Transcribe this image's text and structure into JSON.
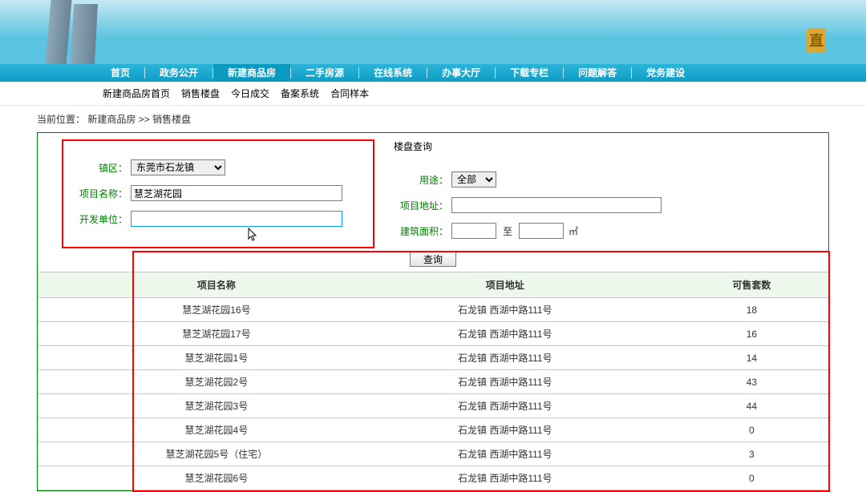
{
  "banner": {
    "right_glyph": "直"
  },
  "main_nav": [
    {
      "label": "首页",
      "active": false
    },
    {
      "label": "政务公开",
      "active": false
    },
    {
      "label": "新建商品房",
      "active": true
    },
    {
      "label": "二手房源",
      "active": false
    },
    {
      "label": "在线系统",
      "active": false
    },
    {
      "label": "办事大厅",
      "active": false
    },
    {
      "label": "下载专栏",
      "active": false
    },
    {
      "label": "问题解答",
      "active": false
    },
    {
      "label": "党务建设",
      "active": false
    }
  ],
  "sub_nav": [
    "新建商品房首页",
    "销售楼盘",
    "今日成交",
    "备案系统",
    "合同样本"
  ],
  "breadcrumb": {
    "label": "当前位置：",
    "items": [
      "新建商品房",
      "销售楼盘"
    ],
    "sep": " >> "
  },
  "search": {
    "section_title": "楼盘查询",
    "district_label": "镇区：",
    "district_value": "东莞市石龙镇",
    "project_name_label": "项目名称：",
    "project_name_value": "慧芝湖花园",
    "developer_label": "开发单位：",
    "developer_value": "",
    "usage_label": "用途：",
    "usage_value": "全部",
    "address_label": "项目地址：",
    "address_value": "",
    "area_label": "建筑面积：",
    "area_from": "",
    "area_to_label": "至",
    "area_to": "",
    "area_unit": "㎡",
    "query_btn": "查询"
  },
  "table": {
    "headers": [
      "项目名称",
      "项目地址",
      "可售套数"
    ],
    "rows": [
      {
        "name": "慧芝湖花园16号",
        "addr": "石龙镇  西湖中路111号",
        "count": "18"
      },
      {
        "name": "慧芝湖花园17号",
        "addr": "石龙镇  西湖中路111号",
        "count": "16"
      },
      {
        "name": "慧芝湖花园1号",
        "addr": "石龙镇  西湖中路111号",
        "count": "14"
      },
      {
        "name": "慧芝湖花园2号",
        "addr": "石龙镇  西湖中路111号",
        "count": "43"
      },
      {
        "name": "慧芝湖花园3号",
        "addr": "石龙镇  西湖中路111号",
        "count": "44"
      },
      {
        "name": "慧芝湖花园4号",
        "addr": "石龙镇  西湖中路111号",
        "count": "0"
      },
      {
        "name": "慧芝湖花园5号（住宅）",
        "addr": "石龙镇  西湖中路111号",
        "count": "3"
      },
      {
        "name": "慧芝湖花园6号",
        "addr": "石龙镇  西湖中路111号",
        "count": "0"
      }
    ]
  }
}
